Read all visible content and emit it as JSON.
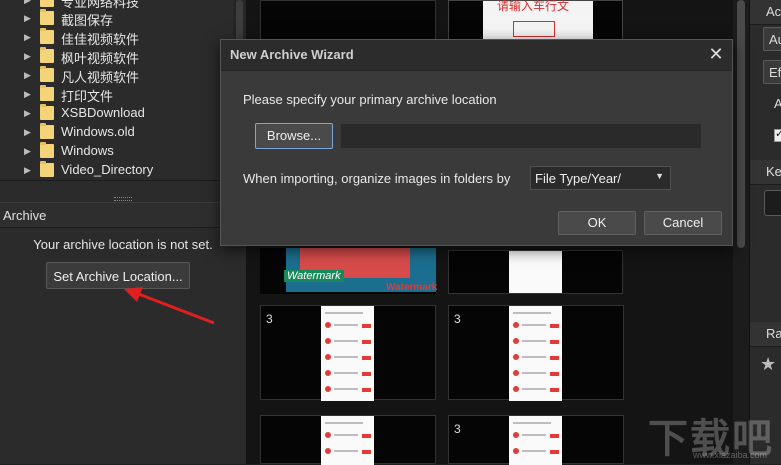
{
  "folder_tree": {
    "items": [
      {
        "label": "专业网络科技"
      },
      {
        "label": "截图保存"
      },
      {
        "label": "佳佳视频软件"
      },
      {
        "label": "枫叶视频软件"
      },
      {
        "label": "凡人视频软件"
      },
      {
        "label": "打印文件"
      },
      {
        "label": "XSBDownload"
      },
      {
        "label": "Windows.old"
      },
      {
        "label": "Windows"
      },
      {
        "label": "Video_Directory"
      }
    ]
  },
  "archive_panel": {
    "title": "Archive",
    "message": "Your archive location is not set.",
    "set_location_label": "Set Archive Location..."
  },
  "grid": {
    "cell_numbers": [
      "3",
      "3",
      "3"
    ],
    "top_card_text": "请输入车行文",
    "watermark_labels": [
      "Watermark",
      "Watermark"
    ]
  },
  "right_panel": {
    "header1": "Ac",
    "input1": "Au",
    "input2": "Ef",
    "row_label": "A",
    "key_header": "Ke",
    "rating_header": "Ra",
    "star_icon": "★"
  },
  "dialog": {
    "title": "New Archive Wizard",
    "close_glyph": "✕",
    "prompt": "Please specify your primary archive location",
    "browse_label": "Browse...",
    "path_value": "",
    "organize_label": "When importing, organize images in folders by",
    "organize_value": "File Type/Year/",
    "ok_label": "OK",
    "cancel_label": "Cancel"
  },
  "site_watermark": {
    "text": "下载吧",
    "url": "www.xiazaiba.com"
  },
  "colors": {
    "annotation_arrow": "#e02020",
    "folder": "#f3d478",
    "focus_border": "#7aa5d8"
  }
}
